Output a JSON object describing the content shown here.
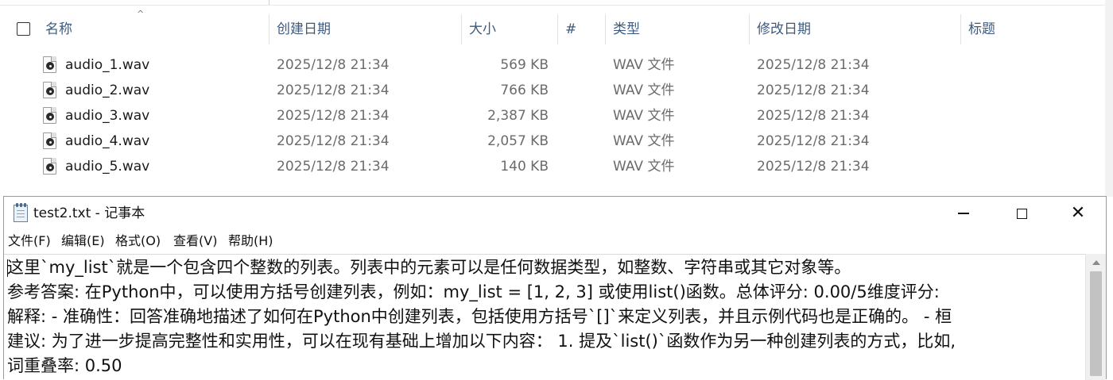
{
  "explorer": {
    "columns": {
      "name": "名称",
      "created": "创建日期",
      "size": "大小",
      "number": "#",
      "type": "类型",
      "modified": "修改日期",
      "title": "标题"
    },
    "files": [
      {
        "name": "audio_1.wav",
        "created": "2025/12/8 21:34",
        "size": "569 KB",
        "type": "WAV 文件",
        "modified": "2025/12/8 21:34"
      },
      {
        "name": "audio_2.wav",
        "created": "2025/12/8 21:34",
        "size": "766 KB",
        "type": "WAV 文件",
        "modified": "2025/12/8 21:34"
      },
      {
        "name": "audio_3.wav",
        "created": "2025/12/8 21:34",
        "size": "2,387 KB",
        "type": "WAV 文件",
        "modified": "2025/12/8 21:34"
      },
      {
        "name": "audio_4.wav",
        "created": "2025/12/8 21:34",
        "size": "2,057 KB",
        "type": "WAV 文件",
        "modified": "2025/12/8 21:34"
      },
      {
        "name": "audio_5.wav",
        "created": "2025/12/8 21:34",
        "size": "140 KB",
        "type": "WAV 文件",
        "modified": "2025/12/8 21:34"
      }
    ],
    "icons": {
      "file": "wav-audio-file-icon",
      "sort": "sort-ascending-caret-icon"
    }
  },
  "notepad": {
    "title": "test2.txt - 记事本",
    "menu": {
      "file": "文件(F)",
      "edit": "编辑(E)",
      "format": "格式(O)",
      "view": "查看(V)",
      "help": "帮助(H)"
    },
    "window_buttons": {
      "minimize": "minimize-icon",
      "maximize": "maximize-icon",
      "close": "✕"
    },
    "content_lines": [
      "这里`my_list`就是一个包含四个整数的列表。列表中的元素可以是任何数据类型，如整数、字符串或其它对象等。",
      "参考答案: 在Python中，可以使用方括号创建列表，例如：my_list = [1, 2, 3] 或使用list()函数。总体评分: 0.00/5维度评分:",
      "解释: - 准确性：回答准确地描述了如何在Python中创建列表，包括使用方括号`[]`来定义列表，并且示例代码也是正确的。 - 桓",
      "建议: 为了进一步提高完整性和实用性，可以在现有基础上增加以下内容： 1. 提及`list()`函数作为另一种创建列表的方式，比如,",
      "词重叠率: 0.50"
    ]
  },
  "colors": {
    "header_text": "#3d5a80",
    "secondary_text": "#6b6b6b",
    "primary_text": "#1a1a1a",
    "scrollbar_thumb": "#c2c2c2"
  }
}
